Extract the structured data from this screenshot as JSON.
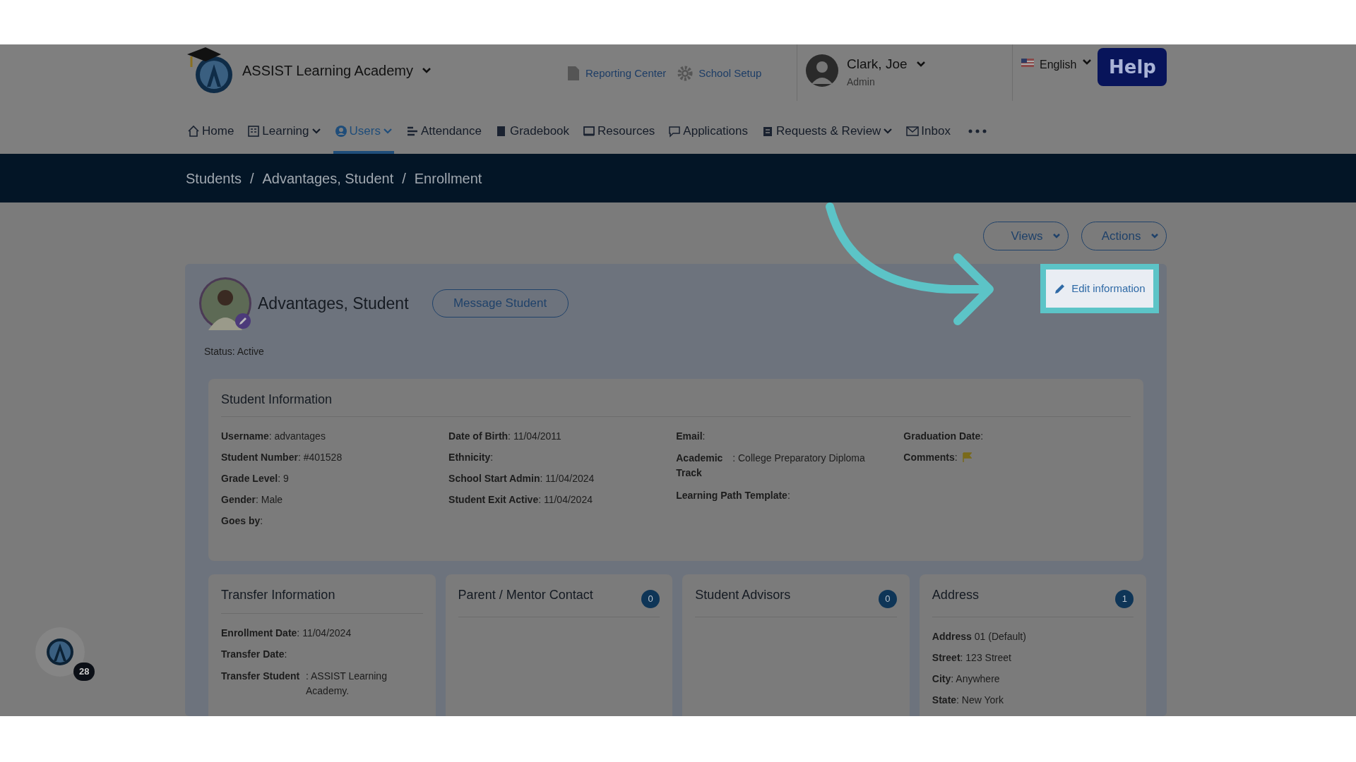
{
  "header": {
    "school_name": "ASSIST Learning Academy",
    "links": [
      "Reporting Center",
      "School Setup"
    ],
    "user": {
      "name": "Clark, Joe",
      "role": "Admin"
    },
    "language": "English",
    "help": "Help"
  },
  "nav": [
    {
      "label": "Home",
      "selected": false,
      "dropdown": false
    },
    {
      "label": "Learning",
      "selected": false,
      "dropdown": true
    },
    {
      "label": "Users",
      "selected": true,
      "dropdown": true
    },
    {
      "label": "Attendance",
      "selected": false,
      "dropdown": false
    },
    {
      "label": "Gradebook",
      "selected": false,
      "dropdown": false
    },
    {
      "label": "Resources",
      "selected": false,
      "dropdown": false
    },
    {
      "label": "Applications",
      "selected": false,
      "dropdown": false
    },
    {
      "label": "Requests & Review",
      "selected": false,
      "dropdown": true
    },
    {
      "label": "Inbox",
      "selected": false,
      "dropdown": false
    }
  ],
  "breadcrumb": [
    "Students",
    "Advantages, Student",
    "Enrollment"
  ],
  "breadcrumb_separator": "/",
  "toolbar": [
    "Views",
    "Actions"
  ],
  "profile": {
    "name": "Advantages, Student",
    "message_button": "Message Student",
    "edit_button": "Edit information",
    "status": "Status: Active"
  },
  "student_information": {
    "title": "Student Information",
    "columns": [
      [
        {
          "kind": "text",
          "text": "**Username**: advantages"
        },
        {
          "kind": "text",
          "text": "**Student Number**: #401528"
        },
        {
          "kind": "text",
          "text": "**Grade Level**: 9"
        },
        {
          "kind": "text",
          "text": "**Gender**: Male"
        },
        {
          "kind": "text",
          "text": "**Goes by**:"
        }
      ],
      [
        {
          "kind": "text",
          "text": "**Date of Birth**: 11/04/2011"
        },
        {
          "kind": "text",
          "text": "**Ethnicity**:"
        },
        {
          "kind": "text",
          "text": "**School Start Admin**: 11/04/2024"
        },
        {
          "kind": "text",
          "text": "**Student Exit Active**: 11/04/2024"
        }
      ],
      [
        {
          "kind": "text",
          "text": "**Email**:"
        },
        {
          "kind": "split",
          "label": "Academic Track",
          "value": ": College Preparatory Diploma"
        },
        {
          "kind": "text",
          "text": "**Learning Path Template**:"
        }
      ],
      [
        {
          "kind": "text",
          "text": "**Graduation Date**:"
        },
        {
          "kind": "flag",
          "text": "**Comments**:"
        }
      ]
    ]
  },
  "cards": [
    {
      "title": "Transfer Information",
      "fields": [
        {
          "kind": "text",
          "text": "**Enrollment Date**: 11/04/2024"
        },
        {
          "kind": "text",
          "text": "**Transfer Date**:"
        },
        {
          "kind": "split",
          "label": "Transfer Student",
          "value": ": ASSIST Learning Academy."
        }
      ]
    },
    {
      "title": "Parent / Mentor Contact",
      "count": "0"
    },
    {
      "title": "Student Advisors",
      "count": "0"
    },
    {
      "title": "Address",
      "count": "1",
      "fields": [
        {
          "kind": "text",
          "text": "**Address** 01 (Default)"
        },
        {
          "kind": "text",
          "text": "**Street**: 123 Street"
        },
        {
          "kind": "text",
          "text": "**City**: Anywhere"
        },
        {
          "kind": "text",
          "text": "**State**: New York"
        }
      ]
    }
  ],
  "chat_badge": "28"
}
